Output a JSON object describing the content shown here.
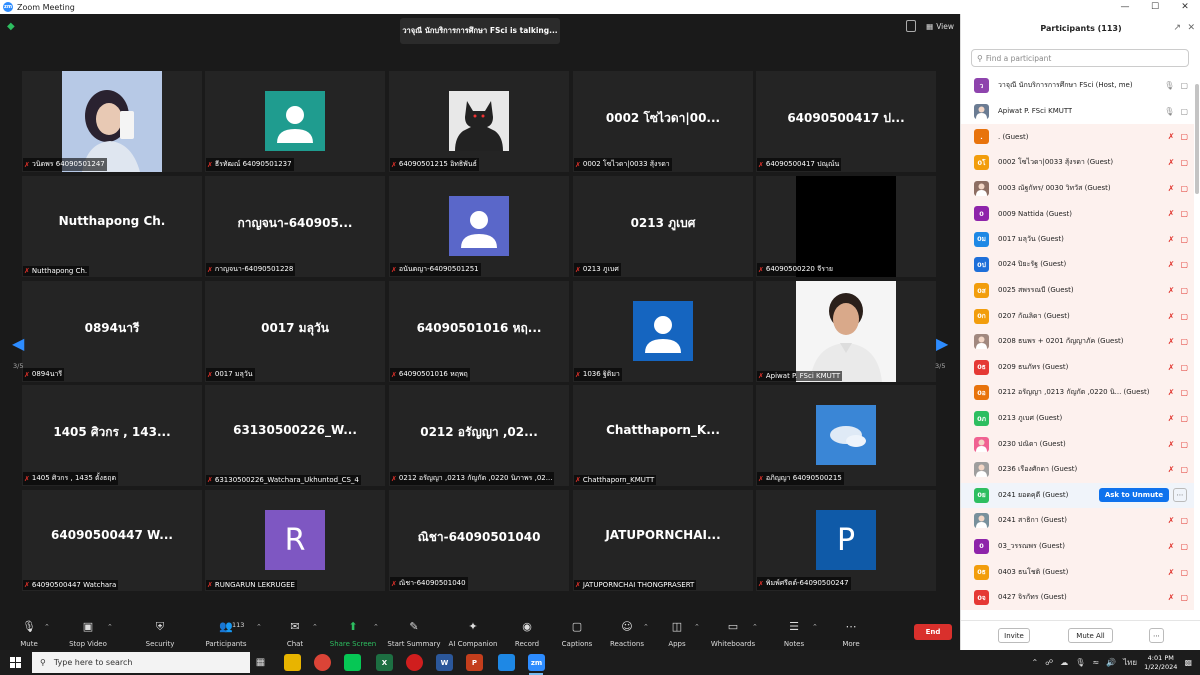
{
  "window": {
    "title": "Zoom Meeting",
    "logo_text": "zm",
    "controls": [
      "—",
      "☐",
      "✕"
    ]
  },
  "meeting": {
    "talking_banner": "วาจุณี นักบริการการศึกษา FSci is talking...",
    "view_label": "View",
    "page_indicator": "3/5"
  },
  "tiles": [
    {
      "label": "วนิดพร 64090501247",
      "big": "",
      "kind": "photo-girl"
    },
    {
      "label": "ธีรทัฒณ์ 64090501237",
      "big": "",
      "kind": "avatar",
      "color": "#1f9c8f"
    },
    {
      "label": "64090501215 อิทธิพันธ์",
      "big": "",
      "kind": "photo-wolf"
    },
    {
      "label": "0002 โซไวดา|0033 สุ้งรดา",
      "big": "0002 โซไวดา|00...",
      "kind": "name"
    },
    {
      "label": "64090500417 ปณุณ์น",
      "big": "64090500417 ป...",
      "kind": "name"
    },
    {
      "label": "Nutthapong Ch.",
      "big": "Nutthapong Ch.",
      "kind": "name"
    },
    {
      "label": "กาญจนา-64090501228",
      "big": "กาญจนา-640905...",
      "kind": "name"
    },
    {
      "label": "อนันตญา-64090501251",
      "big": "",
      "kind": "avatar",
      "color": "#5a67c9"
    },
    {
      "label": "0213 ภูเบศ",
      "big": "0213 ภูเบศ",
      "kind": "name"
    },
    {
      "label": "64090500220 จีราย",
      "big": "",
      "kind": "black"
    },
    {
      "label": "0894นารี",
      "big": "0894นารี",
      "kind": "name"
    },
    {
      "label": "0017 มลุวัน",
      "big": "0017 มลุวัน",
      "kind": "name"
    },
    {
      "label": "64090501016 หฤพฤ",
      "big": "64090501016 หฤ...",
      "kind": "name"
    },
    {
      "label": "1036 ฐิติมา",
      "big": "",
      "kind": "avatar",
      "color": "#1565c0"
    },
    {
      "label": "Apiwat P. FSci KMUTT",
      "big": "",
      "kind": "photo-man"
    },
    {
      "label": "1405 ศิวกร , 1435 ตั้งธฤต",
      "big": "1405 ศิวกร , 143...",
      "kind": "name"
    },
    {
      "label": "63130500226_Watchara_Ukhuntod_CS_4",
      "big": "63130500226_W...",
      "kind": "name"
    },
    {
      "label": "0212 อรัญญา ,0213 กัญกัต ,0220 นิภาพร ,02...",
      "big": "0212 อรัญญา ,02...",
      "kind": "name"
    },
    {
      "label": "Chatthaporn_KMUTT",
      "big": "Chatthaporn_K...",
      "kind": "name"
    },
    {
      "label": "อภิญญา 64090500215",
      "big": "",
      "kind": "photo-sky"
    },
    {
      "label": "64090500447 Watchara",
      "big": "64090500447 W...",
      "kind": "name"
    },
    {
      "label": "RUNGARUN LEKRUGEE",
      "big": "R",
      "kind": "letter",
      "color": "#7e57c2"
    },
    {
      "label": "ณิชา-64090501040",
      "big": "ณิชา-64090501040",
      "kind": "name"
    },
    {
      "label": "JATUPORNCHAI THONGPRASERT",
      "big": "JATUPORNCHAI...",
      "kind": "name"
    },
    {
      "label": "พิมพ์ศรีตต์-64090500247",
      "big": "P",
      "kind": "letter",
      "color": "#0f5aa8"
    }
  ],
  "toolbar": {
    "mute": "Mute",
    "stop_video": "Stop Video",
    "security": "Security",
    "participants": "Participants",
    "participants_count": "113",
    "chat": "Chat",
    "share_screen": "Share Screen",
    "start_summary": "Start Summary",
    "ai_companion": "AI Companion",
    "record": "Record",
    "captions": "Captions",
    "reactions": "Reactions",
    "apps": "Apps",
    "whiteboards": "Whiteboards",
    "notes": "Notes",
    "more": "More",
    "end": "End"
  },
  "panel": {
    "title": "Participants (113)",
    "search_placeholder": "Find a participant",
    "ask_to_unmute": "Ask to Unmute",
    "invite": "Invite",
    "mute_all": "Mute All",
    "participants": [
      {
        "name": "วาจุณี นักบริการการศึกษา FSci (Host, me)",
        "initial": "ว",
        "color": "#8e44ad",
        "guest": false,
        "muted": false
      },
      {
        "name": "Apiwat P. FSci KMUTT",
        "initial": "",
        "color": "#6b7c93",
        "guest": false,
        "muted": false,
        "photo": true
      },
      {
        "name": ". (Guest)",
        "initial": ".",
        "color": "#e8730c",
        "guest": true,
        "muted": true
      },
      {
        "name": "0002 โซไวดา|0033 สุ้งรดา (Guest)",
        "initial": "0โ",
        "color": "#f29d0c",
        "guest": true,
        "muted": true
      },
      {
        "name": "0003 ณัฐกัทร/ 0030 วิทวัส (Guest)",
        "initial": "",
        "color": "#8d6e63",
        "guest": true,
        "muted": true,
        "photo": true
      },
      {
        "name": "0009 Nattida (Guest)",
        "initial": "0",
        "color": "#8e24aa",
        "guest": true,
        "muted": true
      },
      {
        "name": "0017 มลุวัน (Guest)",
        "initial": "0ม",
        "color": "#1e88e5",
        "guest": true,
        "muted": true
      },
      {
        "name": "0024 ปิยะรัฐ (Guest)",
        "initial": "0ป",
        "color": "#1e6fd9",
        "guest": true,
        "muted": true
      },
      {
        "name": "0025 สพรรณบี (Guest)",
        "initial": "0ส",
        "color": "#f29d0c",
        "guest": true,
        "muted": true
      },
      {
        "name": "0207 กัณลิดา (Guest)",
        "initial": "0ก",
        "color": "#f29d0c",
        "guest": true,
        "muted": true
      },
      {
        "name": "0208 ธนพร + 0201 กัญญาภัค (Guest)",
        "initial": "",
        "color": "#a1887f",
        "guest": true,
        "muted": true,
        "photo": true
      },
      {
        "name": "0209 ธนภัทร (Guest)",
        "initial": "0ธ",
        "color": "#e53935",
        "guest": true,
        "muted": true
      },
      {
        "name": "0212 อรัญญา ,0213 กัญกัต ,0220 นิ... (Guest)",
        "initial": "0อ",
        "color": "#e8730c",
        "guest": true,
        "muted": true
      },
      {
        "name": "0213 ภูเบศ (Guest)",
        "initial": "0ภ",
        "color": "#2dbe60",
        "guest": true,
        "muted": true
      },
      {
        "name": "0230 ปณิดา (Guest)",
        "initial": "",
        "color": "#f06292",
        "guest": true,
        "muted": true,
        "photo": true
      },
      {
        "name": "0236 เรืองศักดา (Guest)",
        "initial": "",
        "color": "#9e9e9e",
        "guest": true,
        "muted": true,
        "photo": true
      },
      {
        "name": "0241 ยอดคุดี (Guest)",
        "initial": "0ย",
        "color": "#2dbe60",
        "guest": true,
        "muted": true,
        "hover": true
      },
      {
        "name": "0241 สาธิกา (Guest)",
        "initial": "",
        "color": "#78909c",
        "guest": true,
        "muted": true,
        "photo": true
      },
      {
        "name": "03_วรรณพร (Guest)",
        "initial": "0",
        "color": "#8e24aa",
        "guest": true,
        "muted": true
      },
      {
        "name": "0403 ธนโชติ (Guest)",
        "initial": "0ธ",
        "color": "#f29d0c",
        "guest": true,
        "muted": true
      },
      {
        "name": "0427 จิรกัทร (Guest)",
        "initial": "0จ",
        "color": "#e53935",
        "guest": true,
        "muted": true
      }
    ]
  },
  "taskbar": {
    "search_placeholder": "Type here to search",
    "language": "ไทย",
    "time": "4:01 PM",
    "date": "1/22/2024"
  }
}
